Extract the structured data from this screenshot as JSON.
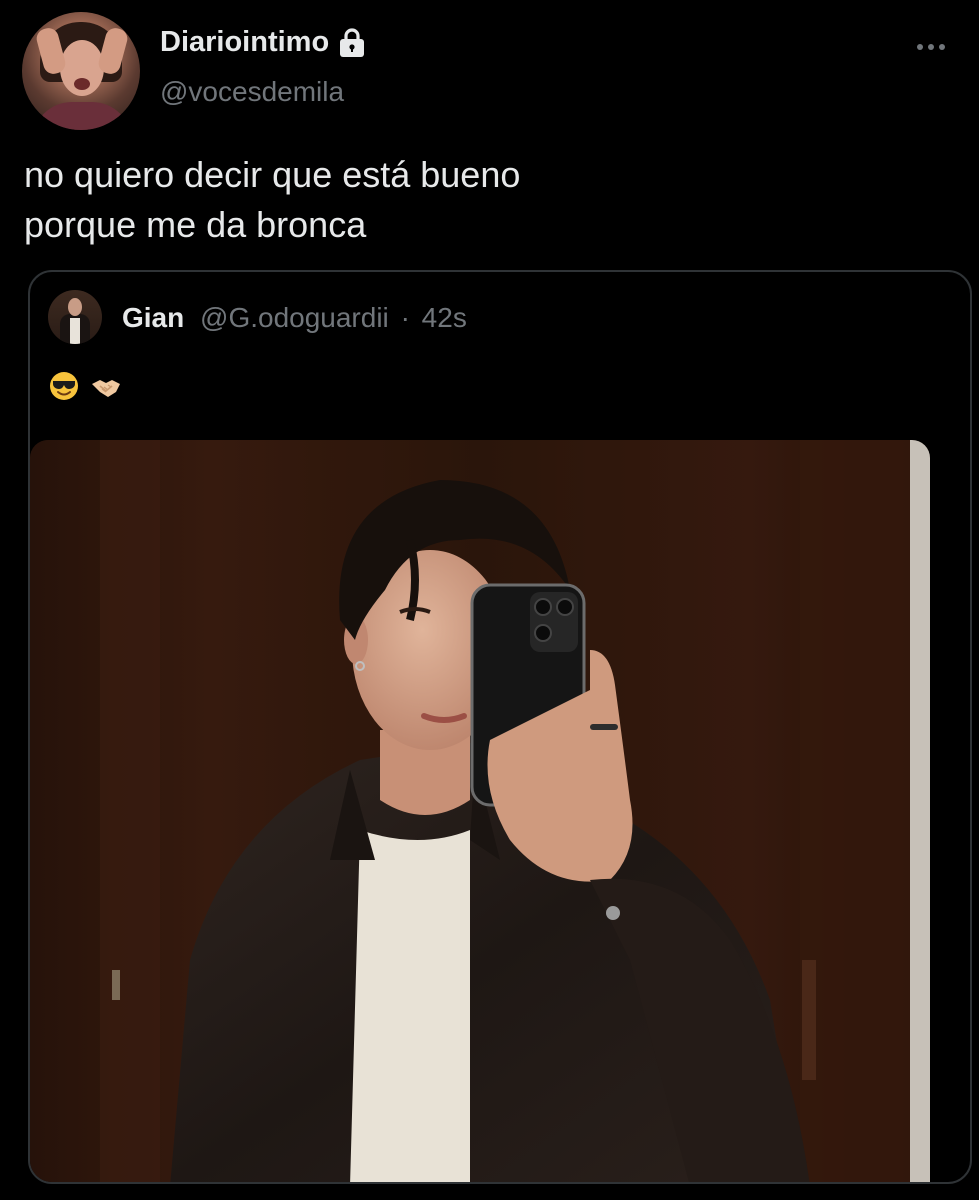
{
  "tweet": {
    "display_name": "Diariointimo",
    "handle": "@vocesdemila",
    "text_lines": [
      "no quiero decir que está bueno",
      "porque me da bronca"
    ]
  },
  "quoted_tweet": {
    "display_name": "Gian",
    "handle": "@G.odoguardii",
    "separator": "·",
    "time": "42s",
    "emojis": [
      "smiling-face-with-sunglasses",
      "handshake"
    ]
  },
  "colors": {
    "background": "#000000",
    "text_primary": "#e7e9ea",
    "text_secondary": "#71767b",
    "border": "#2f3336"
  }
}
